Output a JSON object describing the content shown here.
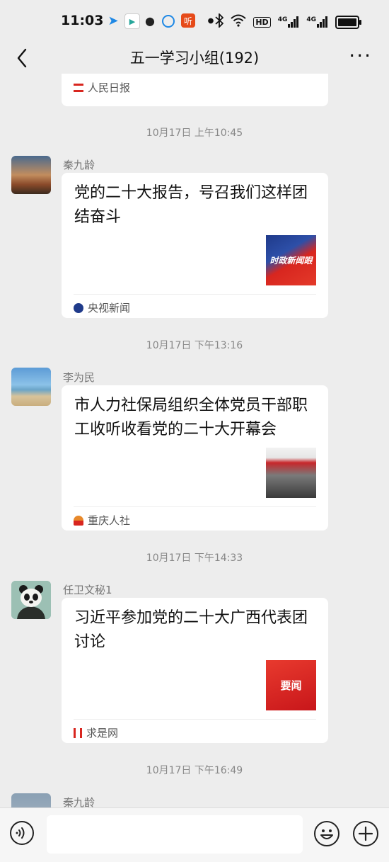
{
  "status_bar": {
    "time": "11:03",
    "icons": [
      "navigation-icon",
      "play-icon",
      "wechat-icon",
      "browser-icon",
      "listen-app-icon",
      "dot-icon",
      "bluetooth-icon",
      "wifi-icon",
      "hd-icon",
      "signal-4g-icon",
      "signal-4g-icon",
      "battery-icon"
    ],
    "hd_label": "HD",
    "net1": "4G",
    "net2": "4G",
    "listen_label": "听"
  },
  "header": {
    "title": "五一学习小组(192)",
    "more": "···"
  },
  "messages": [
    {
      "source": "人民日报"
    },
    {
      "timestamp": "10月17日 上午10:45",
      "sender": "秦九龄",
      "title": "党的二十大报告，号召我们这样团结奋斗",
      "thumb_text": "时政新闻眼",
      "source": "央视新闻"
    },
    {
      "timestamp": "10月17日 下午13:16",
      "sender": "李为民",
      "title": "市人力社保局组织全体党员干部职工收听收看党的二十大开幕会",
      "source": "重庆人社"
    },
    {
      "timestamp": "10月17日 下午14:33",
      "sender": "任卫文秘1",
      "title": "习近平参加党的二十大广西代表团讨论",
      "thumb_text": "要闻",
      "source": "求是网"
    },
    {
      "timestamp": "10月17日 下午16:49",
      "sender": "秦九龄"
    }
  ],
  "input": {
    "value": ""
  },
  "colors": {
    "background": "#ededed",
    "card": "#ffffff",
    "red": "#d8261f",
    "blue": "#1f3a8a"
  }
}
